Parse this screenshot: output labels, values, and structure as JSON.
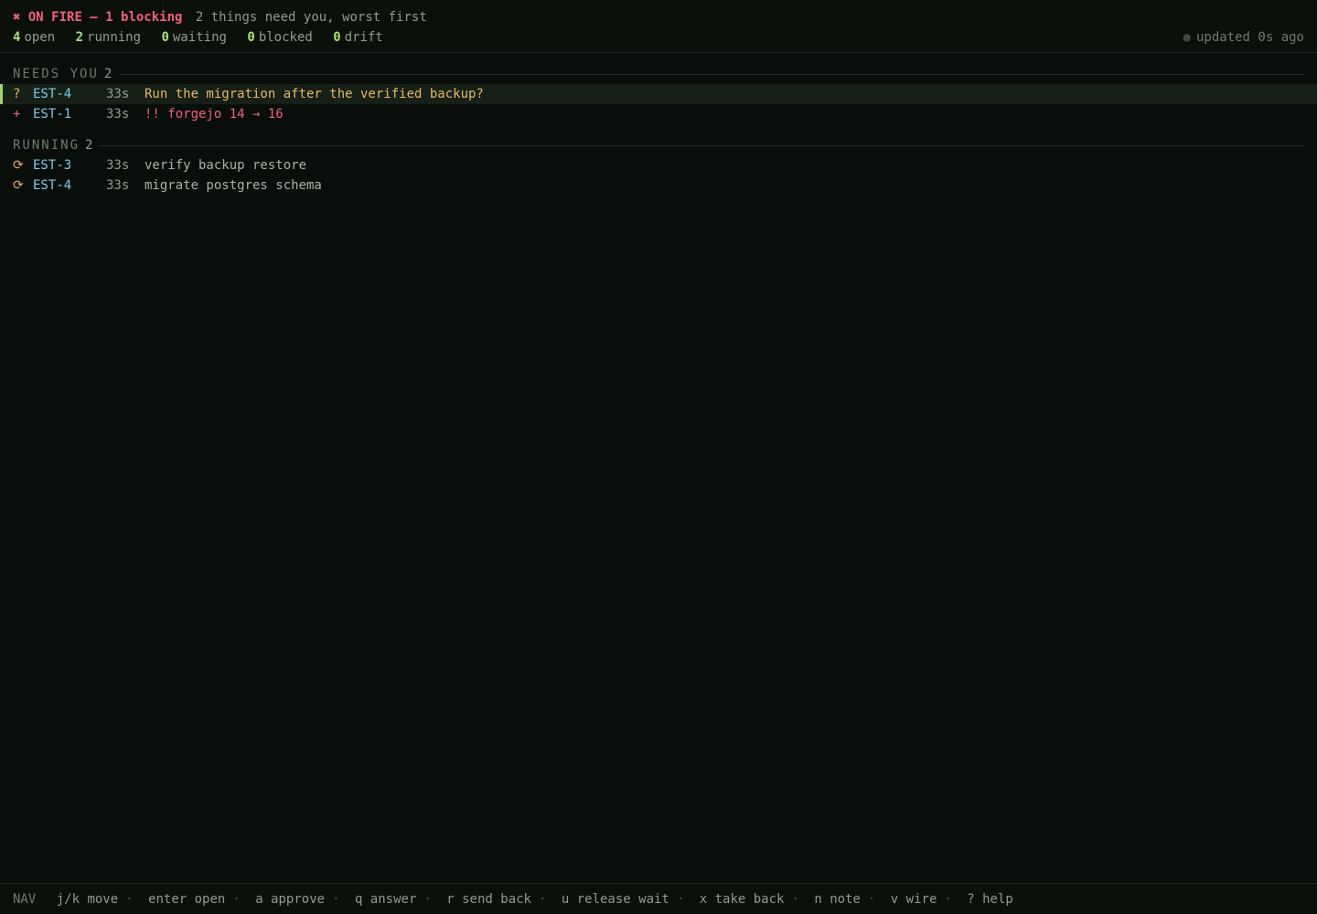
{
  "header": {
    "alert_icon": "✖",
    "alert_label": "ON FIRE — 1 blocking",
    "alert_detail": "2 things need you, worst first",
    "stats": [
      {
        "num": "4",
        "label": "open"
      },
      {
        "num": "2",
        "label": "running"
      },
      {
        "num": "0",
        "label": "waiting"
      },
      {
        "num": "0",
        "label": "blocked"
      },
      {
        "num": "0",
        "label": "drift"
      }
    ],
    "updated_dot": "●",
    "updated": "updated 0s ago"
  },
  "sections": {
    "needs_you": {
      "title": "NEEDS YOU",
      "count": "2",
      "rows": [
        {
          "mark": "?",
          "id": "EST-4",
          "age": "33s",
          "text": "Run the migration after the verified backup?"
        },
        {
          "mark": "+",
          "id": "EST-1",
          "age": "33s",
          "text": "!! forgejo 14 → 16"
        }
      ]
    },
    "running": {
      "title": "RUNNING",
      "count": "2",
      "rows": [
        {
          "mark": "⟳",
          "id": "EST-3",
          "age": "33s",
          "text": "verify backup restore"
        },
        {
          "mark": "⟳",
          "id": "EST-4",
          "age": "33s",
          "text": "migrate postgres schema"
        }
      ]
    }
  },
  "footer": {
    "mode": "NAV",
    "keys": [
      "j/k move",
      "enter open",
      "a approve",
      "q answer",
      "r send back",
      "u release wait",
      "x take back",
      "n note",
      "v wire",
      "? help"
    ],
    "separator": "·"
  },
  "colors": {
    "background": "#0a0e0a",
    "alert": "#f0607a",
    "accent_green": "#a6e07a",
    "id_blue": "#7ec8ee",
    "question_amber": "#e8b860"
  }
}
